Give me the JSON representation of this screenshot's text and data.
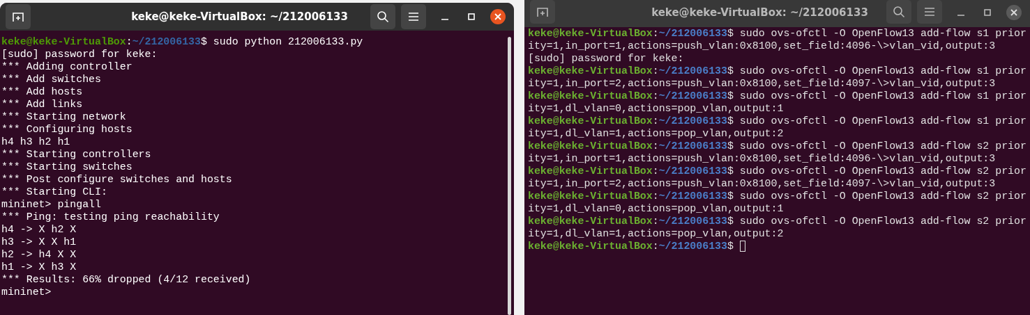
{
  "windows": [
    {
      "title": "keke@keke-VirtualBox: ~/212006133",
      "active": true,
      "lines": [
        {
          "kind": "prompt",
          "user": "keke@keke-VirtualBox",
          "sep": ":",
          "path": "~/212006133",
          "sign": "$",
          "command": " sudo python 212006133.py"
        },
        {
          "kind": "output",
          "text": "[sudo] password for keke:"
        },
        {
          "kind": "output",
          "text": "*** Adding controller"
        },
        {
          "kind": "output",
          "text": "*** Add switches"
        },
        {
          "kind": "output",
          "text": "*** Add hosts"
        },
        {
          "kind": "output",
          "text": "*** Add links"
        },
        {
          "kind": "output",
          "text": "*** Starting network"
        },
        {
          "kind": "output",
          "text": "*** Configuring hosts"
        },
        {
          "kind": "output",
          "text": "h4 h3 h2 h1"
        },
        {
          "kind": "output",
          "text": "*** Starting controllers"
        },
        {
          "kind": "output",
          "text": "*** Starting switches"
        },
        {
          "kind": "output",
          "text": "*** Post configure switches and hosts"
        },
        {
          "kind": "output",
          "text": "*** Starting CLI:"
        },
        {
          "kind": "output",
          "text": "mininet> pingall"
        },
        {
          "kind": "output",
          "text": "*** Ping: testing ping reachability"
        },
        {
          "kind": "output",
          "text": "h4 -> X h2 X"
        },
        {
          "kind": "output",
          "text": "h3 -> X X h1"
        },
        {
          "kind": "output",
          "text": "h2 -> h4 X X"
        },
        {
          "kind": "output",
          "text": "h1 -> X h3 X"
        },
        {
          "kind": "output",
          "text": "*** Results: 66% dropped (4/12 received)"
        },
        {
          "kind": "output",
          "text": "mininet>"
        }
      ]
    },
    {
      "title": "keke@keke-VirtualBox: ~/212006133",
      "active": false,
      "lines": [
        {
          "kind": "prompt",
          "user": "keke@keke-VirtualBox",
          "sep": ":",
          "path": "~/212006133",
          "sign": "$",
          "command": " sudo ovs-ofctl -O OpenFlow13 add-flow s1 prior"
        },
        {
          "kind": "output",
          "text": "ity=1,in_port=1,actions=push_vlan:0x8100,set_field:4096-\\>vlan_vid,output:3"
        },
        {
          "kind": "output",
          "text": "[sudo] password for keke:"
        },
        {
          "kind": "prompt",
          "user": "keke@keke-VirtualBox",
          "sep": ":",
          "path": "~/212006133",
          "sign": "$",
          "command": " sudo ovs-ofctl -O OpenFlow13 add-flow s1 prior"
        },
        {
          "kind": "output",
          "text": "ity=1,in_port=2,actions=push_vlan:0x8100,set_field:4097-\\>vlan_vid,output:3"
        },
        {
          "kind": "prompt",
          "user": "keke@keke-VirtualBox",
          "sep": ":",
          "path": "~/212006133",
          "sign": "$",
          "command": " sudo ovs-ofctl -O OpenFlow13 add-flow s1 prior"
        },
        {
          "kind": "output",
          "text": "ity=1,dl_vlan=0,actions=pop_vlan,output:1"
        },
        {
          "kind": "prompt",
          "user": "keke@keke-VirtualBox",
          "sep": ":",
          "path": "~/212006133",
          "sign": "$",
          "command": " sudo ovs-ofctl -O OpenFlow13 add-flow s1 prior"
        },
        {
          "kind": "output",
          "text": "ity=1,dl_vlan=1,actions=pop_vlan,output:2"
        },
        {
          "kind": "prompt",
          "user": "keke@keke-VirtualBox",
          "sep": ":",
          "path": "~/212006133",
          "sign": "$",
          "command": " sudo ovs-ofctl -O OpenFlow13 add-flow s2 prior"
        },
        {
          "kind": "output",
          "text": "ity=1,in_port=1,actions=push_vlan:0x8100,set_field:4096-\\>vlan_vid,output:3"
        },
        {
          "kind": "prompt",
          "user": "keke@keke-VirtualBox",
          "sep": ":",
          "path": "~/212006133",
          "sign": "$",
          "command": " sudo ovs-ofctl -O OpenFlow13 add-flow s2 prior"
        },
        {
          "kind": "output",
          "text": "ity=1,in_port=2,actions=push_vlan:0x8100,set_field:4097-\\>vlan_vid,output:3"
        },
        {
          "kind": "prompt",
          "user": "keke@keke-VirtualBox",
          "sep": ":",
          "path": "~/212006133",
          "sign": "$",
          "command": " sudo ovs-ofctl -O OpenFlow13 add-flow s2 prior"
        },
        {
          "kind": "output",
          "text": "ity=1,dl_vlan=0,actions=pop_vlan,output:1"
        },
        {
          "kind": "prompt",
          "user": "keke@keke-VirtualBox",
          "sep": ":",
          "path": "~/212006133",
          "sign": "$",
          "command": " sudo ovs-ofctl -O OpenFlow13 add-flow s2 prior"
        },
        {
          "kind": "output",
          "text": "ity=1,dl_vlan=1,actions=pop_vlan,output:2"
        },
        {
          "kind": "prompt",
          "user": "keke@keke-VirtualBox",
          "sep": ":",
          "path": "~/212006133",
          "sign": "$",
          "cursor": true
        }
      ]
    }
  ]
}
